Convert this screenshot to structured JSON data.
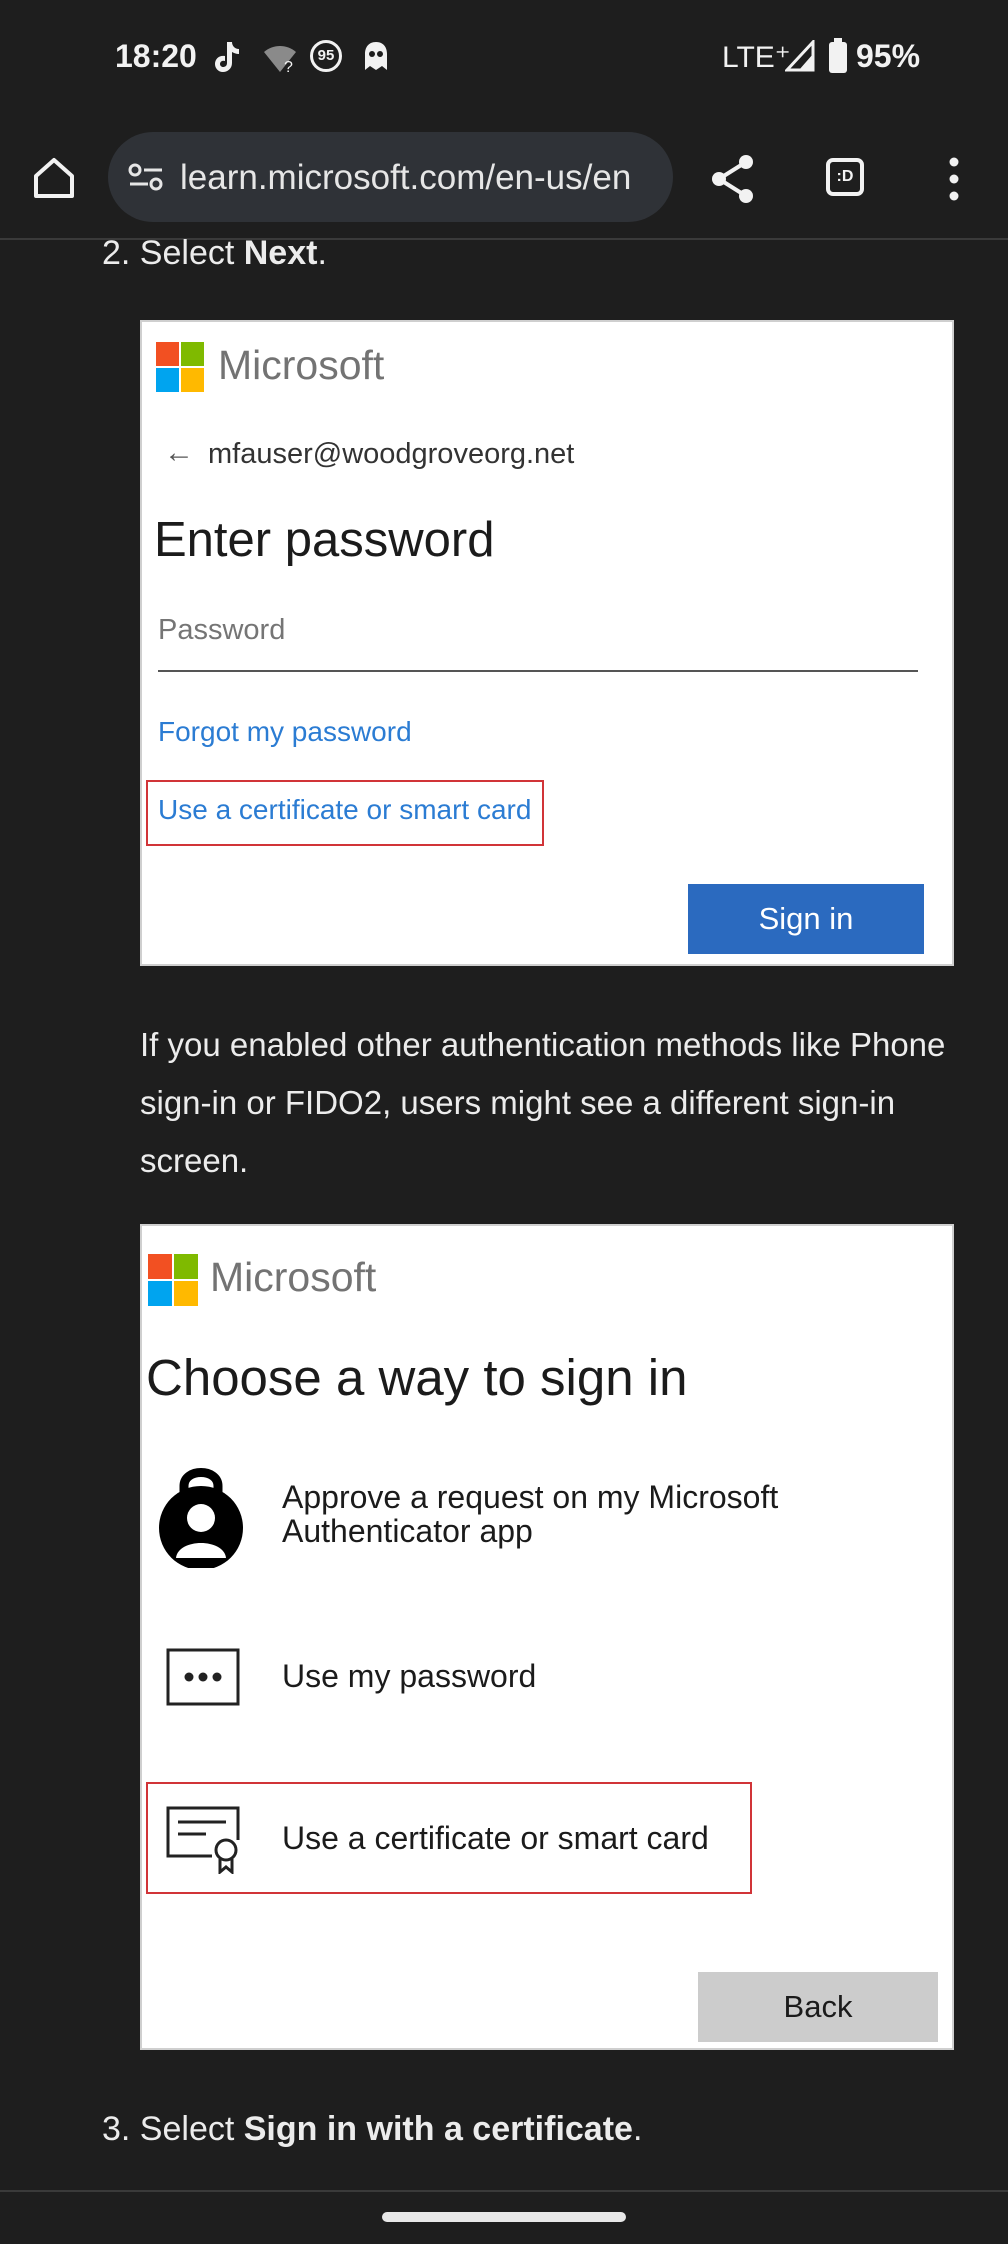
{
  "status_bar": {
    "time": "18:20",
    "notification_badge": "95",
    "network": "LTE⁺",
    "battery": "95%"
  },
  "browser": {
    "url": "learn.microsoft.com/en-us/en",
    "tab_switcher": ":D"
  },
  "article": {
    "step2": {
      "prefix": "2. Select ",
      "bold": "Next",
      "suffix": "."
    },
    "paragraph": "If you enabled other authentication methods like Phone sign-in or FIDO2, users might see a different sign-in screen.",
    "step3": {
      "prefix": "3. Select ",
      "bold": "Sign in with a certificate",
      "suffix": "."
    }
  },
  "screenshot1": {
    "brand": "Microsoft",
    "email": "mfauser@woodgroveorg.net",
    "heading": "Enter password",
    "password_placeholder": "Password",
    "forgot_link": "Forgot my password",
    "cert_link": "Use a certificate or smart card",
    "signin_button": "Sign in"
  },
  "screenshot2": {
    "brand": "Microsoft",
    "heading": "Choose a way to sign in",
    "options": [
      {
        "label": "Approve a request on my Microsoft Authenticator app",
        "icon": "authenticator-icon"
      },
      {
        "label": "Use my password",
        "icon": "password-dots-icon"
      },
      {
        "label": "Use a certificate or smart card",
        "icon": "certificate-icon"
      }
    ],
    "back_button": "Back"
  },
  "colors": {
    "page_background": "#1e1e1e",
    "link": "#2b7cd3",
    "primary_button": "#2b6abf",
    "highlight_border": "#d13438",
    "ms_red": "#f25022",
    "ms_green": "#7fba00",
    "ms_blue": "#00a4ef",
    "ms_yellow": "#ffb900"
  }
}
